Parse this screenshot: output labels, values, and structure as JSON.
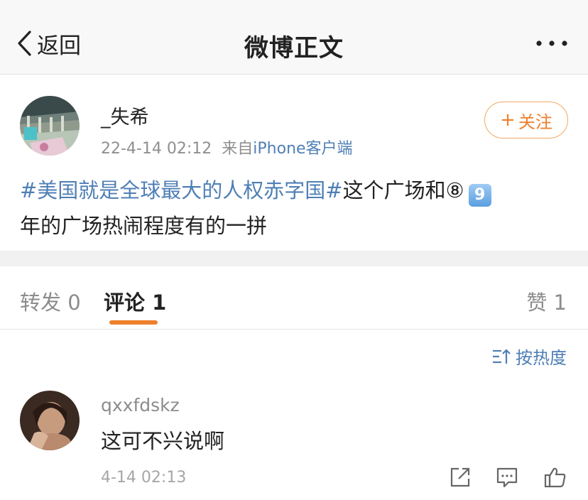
{
  "header": {
    "back_label": "返回",
    "title": "微博正文"
  },
  "post": {
    "username": "_失希",
    "time": "22-4-14 02:12",
    "from_prefix": "来自",
    "source": "iPhone客户端",
    "follow_label": "关注",
    "topic": "#美国就是全球最大的人权赤字国#",
    "text_part1": "这个广场和⑧",
    "keycap": "9",
    "text_part2": "年的广场热闹程度有的一拼"
  },
  "tabs": {
    "repost": "转发 0",
    "comment": "评论 1",
    "like": "赞 1"
  },
  "sort": {
    "label": "按热度"
  },
  "comment": {
    "username": "qxxfdskz",
    "text": "这可不兴说啊",
    "time": "4-14 02:13"
  },
  "colors": {
    "accent_orange": "#ee7f2b",
    "link_blue": "#4f7fb5",
    "divider_gray": "#f1f1f1"
  }
}
